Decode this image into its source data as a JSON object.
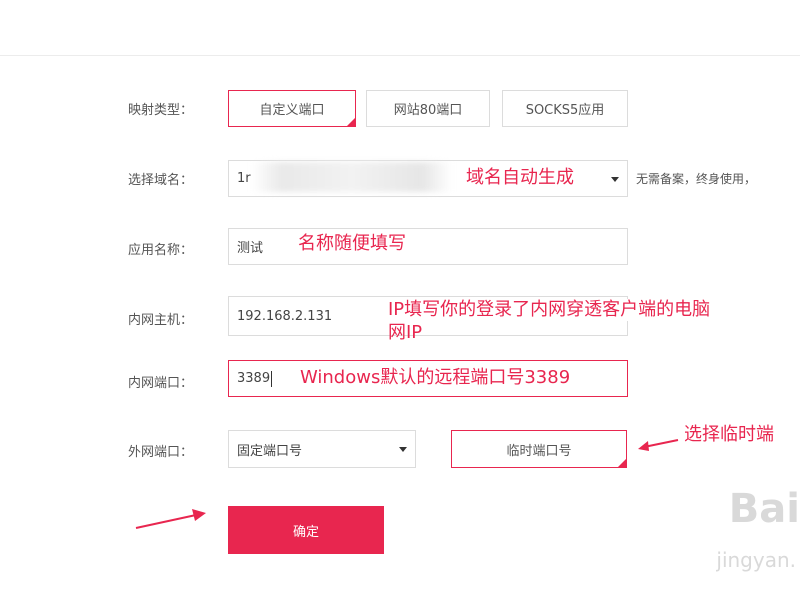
{
  "form": {
    "mapping_type_label": "映射类型：",
    "mapping_tabs": [
      {
        "label": "自定义端口",
        "active": true
      },
      {
        "label": "网站80端口",
        "active": false
      },
      {
        "label": "SOCKS5应用",
        "active": false
      }
    ],
    "domain_label": "选择域名：",
    "domain_value": "1r",
    "domain_note": "无需备案，终身使用，",
    "app_name_label": "应用名称：",
    "app_name_value": "测试",
    "host_label": "内网主机：",
    "host_value": "192.168.2.131",
    "port_label": "内网端口：",
    "port_value": "3389",
    "external_port_label": "外网端口：",
    "external_port_select": "固定端口号",
    "temp_port_button": "临时端口号",
    "submit_label": "确定"
  },
  "annotations": {
    "domain": "域名自动生成",
    "app_name": "名称随便填写",
    "host_line1": "IP填写你的登录了内网穿透客户端的电脑",
    "host_line2": "网IP",
    "port": "Windows默认的远程端口号3389",
    "temp_port": "选择临时端"
  },
  "watermark": {
    "text": "Bai",
    "sub": "jingyan."
  },
  "colors": {
    "accent": "#e8264f",
    "border": "#dcdcdc",
    "label": "#555555"
  }
}
